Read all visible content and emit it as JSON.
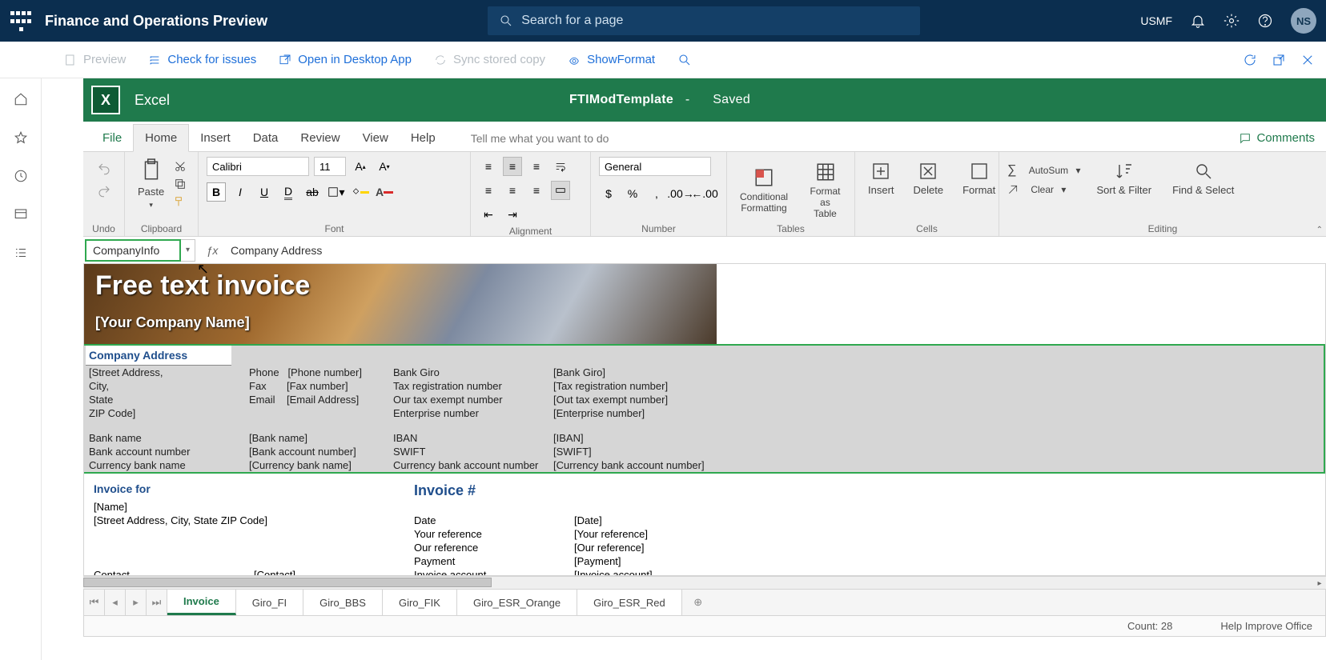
{
  "header": {
    "app_title": "Finance and Operations Preview",
    "search_placeholder": "Search for a page",
    "company": "USMF",
    "user_initials": "NS"
  },
  "subbar": {
    "preview": "Preview",
    "check": "Check for issues",
    "open_desktop": "Open in Desktop App",
    "sync": "Sync stored copy",
    "showformat": "ShowFormat"
  },
  "excel": {
    "app": "Excel",
    "doc_name": "FTIModTemplate",
    "status": "Saved",
    "tabs": {
      "file": "File",
      "home": "Home",
      "insert": "Insert",
      "data": "Data",
      "review": "Review",
      "view": "View",
      "help": "Help",
      "tell": "Tell me what you want to do",
      "comments": "Comments"
    },
    "ribbon": {
      "undo_lbl": "Undo",
      "clipboard_lbl": "Clipboard",
      "paste": "Paste",
      "font_lbl": "Font",
      "font": "Calibri",
      "size": "11",
      "align_lbl": "Alignment",
      "num_lbl": "Number",
      "num_format": "General",
      "tables_lbl": "Tables",
      "condfmt": "Conditional Formatting",
      "fmtTable": "Format as Table",
      "cells_lbl": "Cells",
      "insert": "Insert",
      "delete": "Delete",
      "format": "Format",
      "editing_lbl": "Editing",
      "autosum": "AutoSum",
      "clear": "Clear",
      "sortfilter": "Sort & Filter",
      "findselect": "Find & Select"
    },
    "namebox": "CompanyInfo",
    "formula": "Company Address"
  },
  "worksheet": {
    "title": "Free text invoice",
    "company_name_ph": "[Your Company Name]",
    "company_addr_h": "Company Address",
    "addr_lines": {
      "street": "[Street Address,",
      "city": "City,",
      "state": "State",
      "zip": "ZIP Code]"
    },
    "cols": {
      "phone": "Phone",
      "phone_v": "[Phone number]",
      "fax": "Fax",
      "fax_v": "[Fax number]",
      "email": "Email",
      "email_v": "[Email Address]",
      "bankgiro": "Bank Giro",
      "bankgiro_v": "[Bank Giro]",
      "taxreg": "Tax registration number",
      "taxreg_v": "[Tax registration number]",
      "taxexempt": "Our tax exempt number",
      "taxexempt_v": "[Out tax exempt number]",
      "ent": "Enterprise number",
      "ent_v": "[Enterprise number]",
      "bankname": "Bank name",
      "bankname_v": "[Bank name]",
      "bankacct": "Bank account number",
      "bankacct_v": "[Bank account number]",
      "curbank": "Currency bank name",
      "curbank_v": "[Currency bank name]",
      "iban": "IBAN",
      "iban_v": "[IBAN]",
      "swift": "SWIFT",
      "swift_v": "[SWIFT]",
      "curacct": "Currency bank account number",
      "curacct_v": "[Currency bank account number]"
    },
    "invoice_for": "Invoice for",
    "inv_name": "[Name]",
    "inv_addr": "[Street Address, City, State ZIP Code]",
    "contact": "Contact",
    "contact_v": "[Contact]",
    "invoice_num": "Invoice #",
    "date": "Date",
    "date_v": "[Date]",
    "yourref": "Your reference",
    "yourref_v": "[Your reference]",
    "ourref": "Our reference",
    "ourref_v": "[Our reference]",
    "payment": "Payment",
    "payment_v": "[Payment]",
    "invacct": "Invoice account",
    "invacct_v": "[Invoice account]"
  },
  "sheets": [
    "Invoice",
    "Giro_FI",
    "Giro_BBS",
    "Giro_FIK",
    "Giro_ESR_Orange",
    "Giro_ESR_Red"
  ],
  "status": {
    "count": "Count: 28",
    "help": "Help Improve Office"
  }
}
